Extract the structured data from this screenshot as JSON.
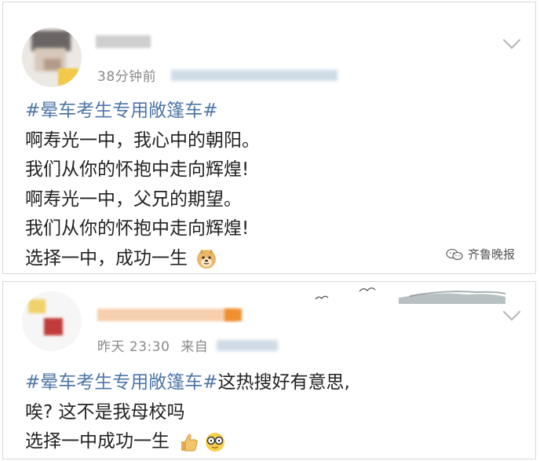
{
  "post1": {
    "time": "38分钟前",
    "hashtag": "#晕车考生专用敞篷车#",
    "lines": [
      "啊寿光一中，我心中的朝阳。",
      "我们从你的怀抱中走向辉煌!",
      "啊寿光一中，父兄的期望。",
      "我们从你的怀抱中走向辉煌!",
      "选择一中，成功一生"
    ],
    "emoji": "doge-emoji",
    "watermark": "齐鲁晚报",
    "menu_icon": "chevron-down-icon"
  },
  "post2": {
    "time": "昨天 23:30",
    "source_prefix": "来自",
    "hashtag": "#晕车考生专用敞篷车#",
    "line1_rest": "这热搜好有意思,",
    "line2": "唉? 这不是我母校吗",
    "line3": "选择一中成功一生",
    "emojis": [
      "thumbs-up-emoji",
      "glasses-emoji"
    ],
    "menu_icon": "chevron-down-icon"
  },
  "colors": {
    "hashtag": "#4f76a8",
    "text": "#222222",
    "meta": "#8a8a8a",
    "border": "#d9d9d9"
  }
}
